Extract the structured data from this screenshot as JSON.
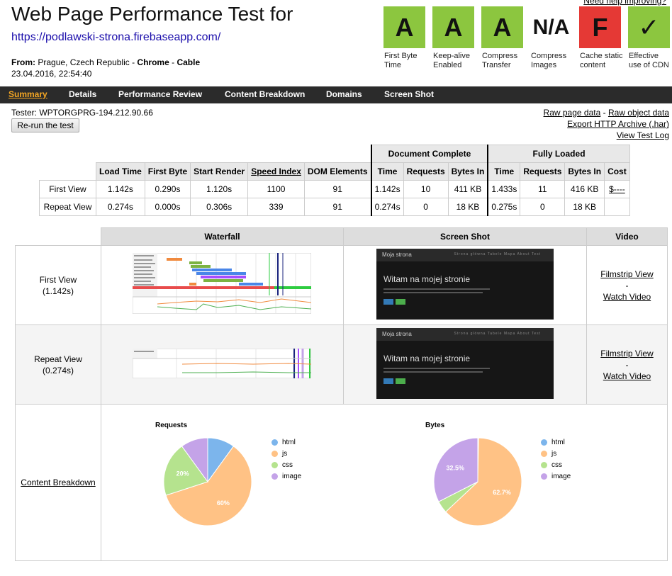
{
  "header": {
    "title": "Web Page Performance Test for",
    "url": "https://podlawski-strona.firebaseapp.com/",
    "from_label": "From:",
    "from_location": "Prague, Czech Republic",
    "from_sep1": " - ",
    "browser": "Chrome",
    "from_sep2": " - ",
    "connection": "Cable",
    "datetime": "23.04.2016, 22:54:40",
    "help_link": "Need help improving?"
  },
  "grades": [
    {
      "grade": "A",
      "label": "First Byte Time",
      "color": "#8cc63f"
    },
    {
      "grade": "A",
      "label": "Keep-alive Enabled",
      "color": "#8cc63f"
    },
    {
      "grade": "A",
      "label": "Compress Transfer",
      "color": "#8cc63f"
    },
    {
      "grade": "N/A",
      "label": "Compress Images",
      "color": "#ffffff"
    },
    {
      "grade": "F",
      "label": "Cache static content",
      "color": "#e53935"
    },
    {
      "grade": "✓",
      "label": "Effective use of CDN",
      "color": "#8cc63f"
    }
  ],
  "nav": {
    "summary": "Summary",
    "details": "Details",
    "performance_review": "Performance Review",
    "content_breakdown": "Content Breakdown",
    "domains": "Domains",
    "screen_shot": "Screen Shot"
  },
  "tester": "Tester: WPTORGPRG-194.212.90.66",
  "rerun_label": "Re-run the test",
  "result_links": {
    "raw_page": "Raw page data",
    "sep": " - ",
    "raw_object": "Raw object data",
    "export_har": "Export HTTP Archive (.har)",
    "view_log": "View Test Log"
  },
  "results": {
    "group_headers": {
      "document_complete": "Document Complete",
      "fully_loaded": "Fully Loaded"
    },
    "columns": [
      "Load Time",
      "First Byte",
      "Start Render",
      "Speed Index",
      "DOM Elements",
      "Time",
      "Requests",
      "Bytes In",
      "Time",
      "Requests",
      "Bytes In",
      "Cost"
    ],
    "rows": [
      {
        "label": "First View",
        "cells": [
          "1.142s",
          "0.290s",
          "1.120s",
          "1100",
          "91",
          "1.142s",
          "10",
          "411 KB",
          "1.433s",
          "11",
          "416 KB",
          "$----"
        ]
      },
      {
        "label": "Repeat View",
        "cells": [
          "0.274s",
          "0.000s",
          "0.306s",
          "339",
          "91",
          "0.274s",
          "0",
          "18 KB",
          "0.275s",
          "0",
          "18 KB",
          ""
        ]
      }
    ]
  },
  "grid": {
    "headers": {
      "waterfall": "Waterfall",
      "screenshot": "Screen Shot",
      "video": "Video"
    },
    "first_view": {
      "label": "First View",
      "time": "(1.142s)"
    },
    "repeat_view": {
      "label": "Repeat View",
      "time": "(0.274s)"
    },
    "filmstrip": "Filmstrip View",
    "dash": "-",
    "watch_video": "Watch Video",
    "content_breakdown": "Content Breakdown"
  },
  "screenshot_thumb": {
    "brand": "Moja strona",
    "menu": "Strona główna   Tabele   Mapa   About   Test",
    "hero": "Witam na mojej stronie"
  },
  "legend": {
    "html": {
      "label": "html",
      "color": "#7cb5ec"
    },
    "js": {
      "label": "js",
      "color": "#ffc285"
    },
    "css": {
      "label": "css",
      "color": "#b5e38e"
    },
    "image": {
      "label": "image",
      "color": "#c4a3e8"
    }
  },
  "chart_data": [
    {
      "type": "pie",
      "title": "Requests",
      "categories": [
        "html",
        "js",
        "css",
        "image"
      ],
      "values": [
        10,
        60,
        20,
        10
      ],
      "data_labels": [
        "",
        "60%",
        "20%",
        ""
      ]
    },
    {
      "type": "pie",
      "title": "Bytes",
      "categories": [
        "html",
        "js",
        "css",
        "image"
      ],
      "values": [
        0.3,
        62.7,
        4.5,
        32.5
      ],
      "data_labels": [
        "",
        "62.7%",
        "",
        "32.5%"
      ]
    }
  ]
}
